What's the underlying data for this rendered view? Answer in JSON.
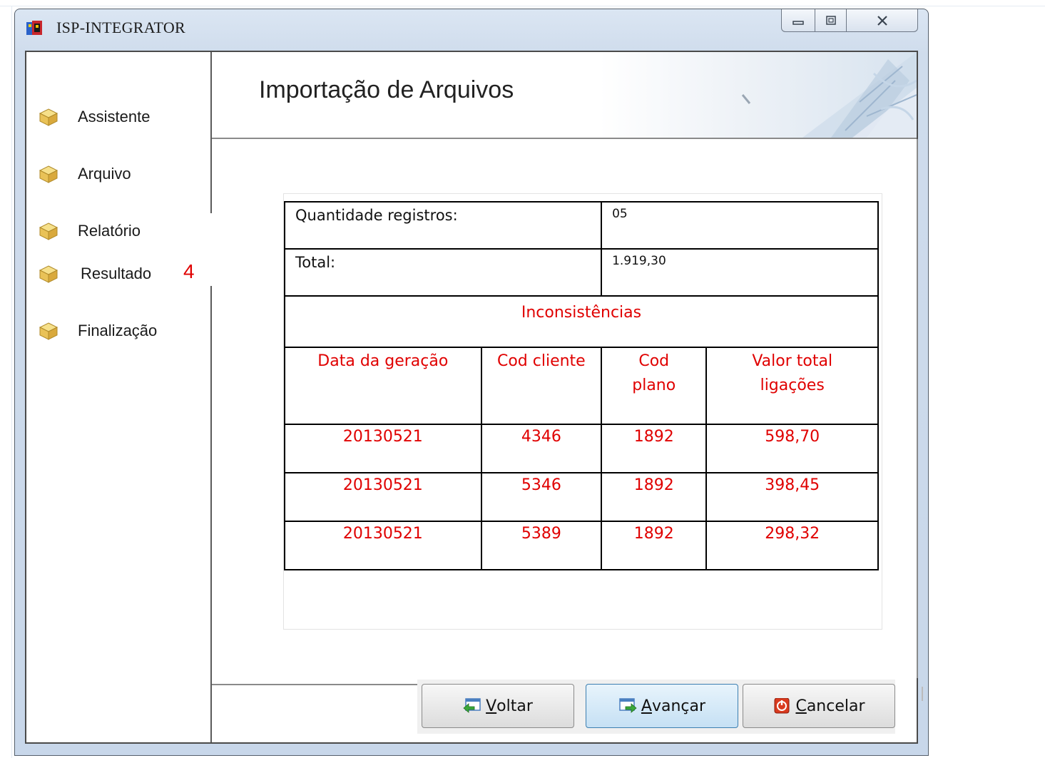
{
  "window": {
    "title": "ISP-INTEGRATOR"
  },
  "sidebar": {
    "items": [
      {
        "label": "Assistente",
        "icon": "package-icon"
      },
      {
        "label": "Arquivo",
        "icon": "package-icon"
      },
      {
        "label": "Relatório",
        "icon": "package-icon"
      },
      {
        "label": "Resultado",
        "icon": "package-icon"
      },
      {
        "label": "Finalização",
        "icon": "package-icon"
      }
    ],
    "step_annotation": "4"
  },
  "header": {
    "title": "Importação de Arquivos"
  },
  "report": {
    "quantity_label": "Quantidade registros:",
    "quantity_value": "05",
    "total_label": "Total:",
    "total_value": "1.919,30",
    "section_title": "Inconsistências",
    "columns": [
      "Data da geração",
      "Cod cliente",
      "Cod plano",
      "Valor total ligações"
    ],
    "column_lines": [
      [
        "Data da geração"
      ],
      [
        "Cod cliente"
      ],
      [
        "Cod",
        "plano"
      ],
      [
        "Valor total",
        "ligações"
      ]
    ],
    "rows": [
      [
        "20130521",
        "4346",
        "1892",
        "598,70"
      ],
      [
        "20130521",
        "5346",
        "1892",
        "398,45"
      ],
      [
        "20130521",
        "5389",
        "1892",
        "298,32"
      ]
    ]
  },
  "footer": {
    "back_mnemonic": "V",
    "back_rest": "oltar",
    "next_mnemonic": "A",
    "next_rest": "vançar",
    "cancel_mnemonic": "C",
    "cancel_rest": "ancelar"
  },
  "colors": {
    "accent_red": "#e00000",
    "primary_button": "#c5e0f4"
  }
}
